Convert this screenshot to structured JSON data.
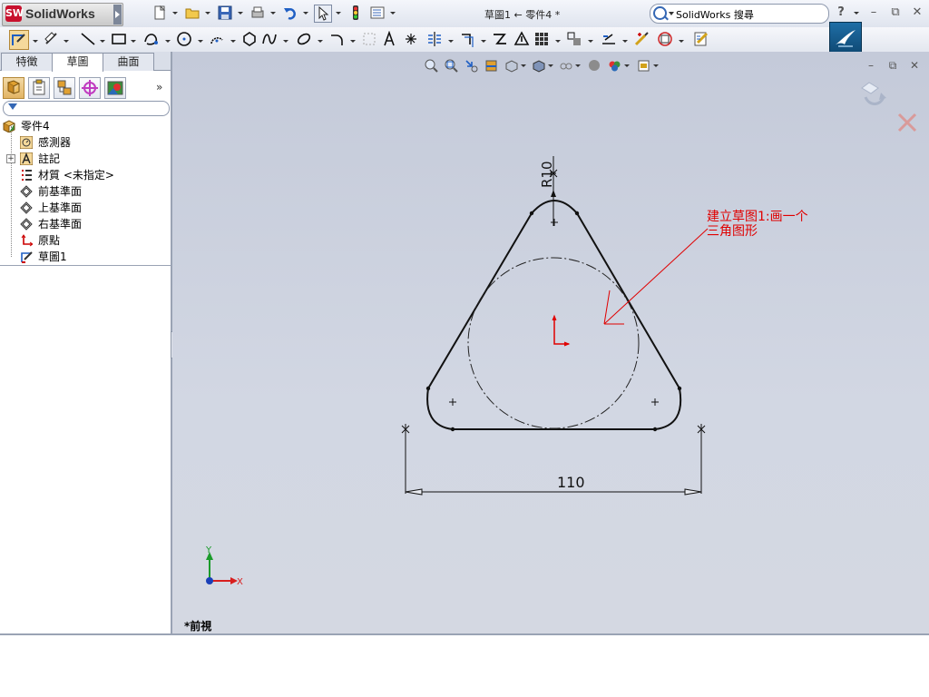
{
  "app": {
    "brand": "SolidWorks",
    "document_title": "草圖1 ← 零件4 *",
    "search_text": "SolidWorks 搜尋",
    "help_label": "?",
    "window_controls": [
      "–",
      "⧉",
      "✕"
    ]
  },
  "icons": {
    "titlebar": [
      "new-document-icon",
      "open-folder-icon",
      "save-icon",
      "print-icon",
      "undo-icon",
      "select-arrow-icon",
      "rebuild-icon",
      "options-icon"
    ],
    "sketch_toolbar": [
      "sketch-icon",
      "smart-dimension-icon",
      "line-icon",
      "rectangle-icon",
      "spline-icon",
      "circle-icon",
      "arc-icon",
      "polygon-icon",
      "curve-icon",
      "ellipse-icon",
      "fillet-icon",
      "construction-icon",
      "text-icon",
      "point-icon",
      "mirror-icon",
      "offset-icon",
      "trim-icon",
      "convert-icon",
      "pattern-icon",
      "move-icon",
      "relations-icon",
      "repair-icon",
      "quick-snap-icon",
      "instant-3d-icon"
    ],
    "view_toolbar": [
      "zoom-fit-icon",
      "zoom-area-icon",
      "previous-view-icon",
      "section-view-icon",
      "view-orientation-icon",
      "display-style-icon",
      "hide-show-icon",
      "edit-appearance-icon",
      "scene-icon",
      "view-settings-icon"
    ]
  },
  "panel": {
    "tabs": [
      {
        "label": "特徵",
        "active": false
      },
      {
        "label": "草圖",
        "active": true
      },
      {
        "label": "曲面",
        "active": false
      }
    ],
    "manager_icons": [
      "feature-manager-icon",
      "property-manager-icon",
      "configuration-manager-icon",
      "dimxpert-manager-icon",
      "display-manager-icon"
    ],
    "more_label": "»",
    "tree": [
      {
        "label": "零件4",
        "icon": "part-icon",
        "level": 0
      },
      {
        "label": "感測器",
        "icon": "sensor-icon",
        "level": 1
      },
      {
        "label": "註記",
        "icon": "annotation-icon",
        "level": 1,
        "expandable": true
      },
      {
        "label": "材質 <未指定>",
        "icon": "material-icon",
        "level": 1
      },
      {
        "label": "前基準面",
        "icon": "plane-icon",
        "level": 1
      },
      {
        "label": "上基準面",
        "icon": "plane-icon",
        "level": 1
      },
      {
        "label": "右基準面",
        "icon": "plane-icon",
        "level": 1
      },
      {
        "label": "原點",
        "icon": "origin-icon",
        "level": 1
      },
      {
        "label": "草圖1",
        "icon": "sketch-icon",
        "level": 1
      }
    ]
  },
  "graphics": {
    "view_label": "*前視",
    "dimension_radius": "R10",
    "dimension_width": "110",
    "annotation_line1": "建立草图1:画一个",
    "annotation_line2": "三角图形",
    "axis_x": "X",
    "axis_y": "Y",
    "colors": {
      "sketch_line": "#111111",
      "annotation": "#e00000",
      "origin": "#e00000",
      "axis_x": "#d81e1e",
      "axis_y": "#1a9b2a",
      "background_top": "#c4cad9"
    }
  }
}
